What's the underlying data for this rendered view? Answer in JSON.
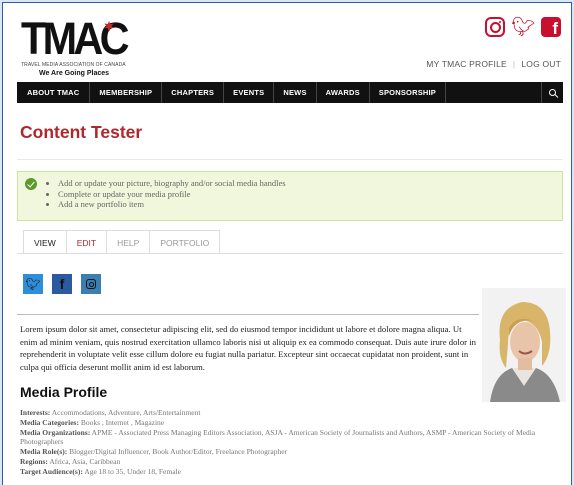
{
  "brand": {
    "logo_word": "TMAC",
    "logo_sub": "TRAVEL MEDIA ASSOCIATION OF CANADA",
    "logo_tag": "We Are Going Places"
  },
  "header": {
    "social": [
      "instagram-icon",
      "twitter-icon",
      "facebook-icon"
    ],
    "my_profile": "MY TMAC PROFILE",
    "separator": "|",
    "logout": "LOG OUT"
  },
  "nav": {
    "items": [
      "ABOUT TMAC",
      "MEMBERSHIP",
      "CHAPTERS",
      "EVENTS",
      "NEWS",
      "AWARDS",
      "SPONSORSHIP"
    ]
  },
  "page": {
    "title": "Content Tester"
  },
  "notice": {
    "items": [
      "Add or update your picture, biography and/or social media handles",
      "Complete or update your media profile",
      "Add a new portfolio item"
    ]
  },
  "tabs": [
    "VIEW",
    "EDIT",
    "HELP",
    "PORTFOLIO"
  ],
  "bio": "Lorem ipsum dolor sit amet, consectetur adipiscing elit, sed do eiusmod tempor incididunt ut labore et dolore magna aliqua. Ut enim ad minim veniam, quis nostrud exercitation ullamco laboris nisi ut aliquip ex ea commodo consequat. Duis aute irure dolor in reprehenderit in voluptate velit esse cillum dolore eu fugiat nulla pariatur. Excepteur sint occaecat cupidatat non proident, sunt in culpa qui officia deserunt mollit anim id est laborum.",
  "media_profile": {
    "title": "Media Profile",
    "fields": [
      {
        "label": "Interests:",
        "value": "Accommodations, Adventure, Arts/Entertainment"
      },
      {
        "label": "Media Categories:",
        "value": "Books , Internet , Magazine"
      },
      {
        "label": "Media Organizations:",
        "value": "APME - Associated Press Managing Editors Association, ASJA - American Society of Journalists and Authors, ASMP - American Society of Media Photographers"
      },
      {
        "label": "Media Role(s):",
        "value": "Blogger/Digital Influencer, Book Author/Editor, Freelance Photographer"
      },
      {
        "label": "Regions:",
        "value": "Africa, Asia, Caribbean"
      },
      {
        "label": "Target Audience(s):",
        "value": "Age 18 to 35, Under 18, Female"
      }
    ]
  },
  "colors": {
    "brand_red": "#b0282c",
    "nav_bg": "#111111",
    "notice_bg": "#f1f7dc"
  }
}
